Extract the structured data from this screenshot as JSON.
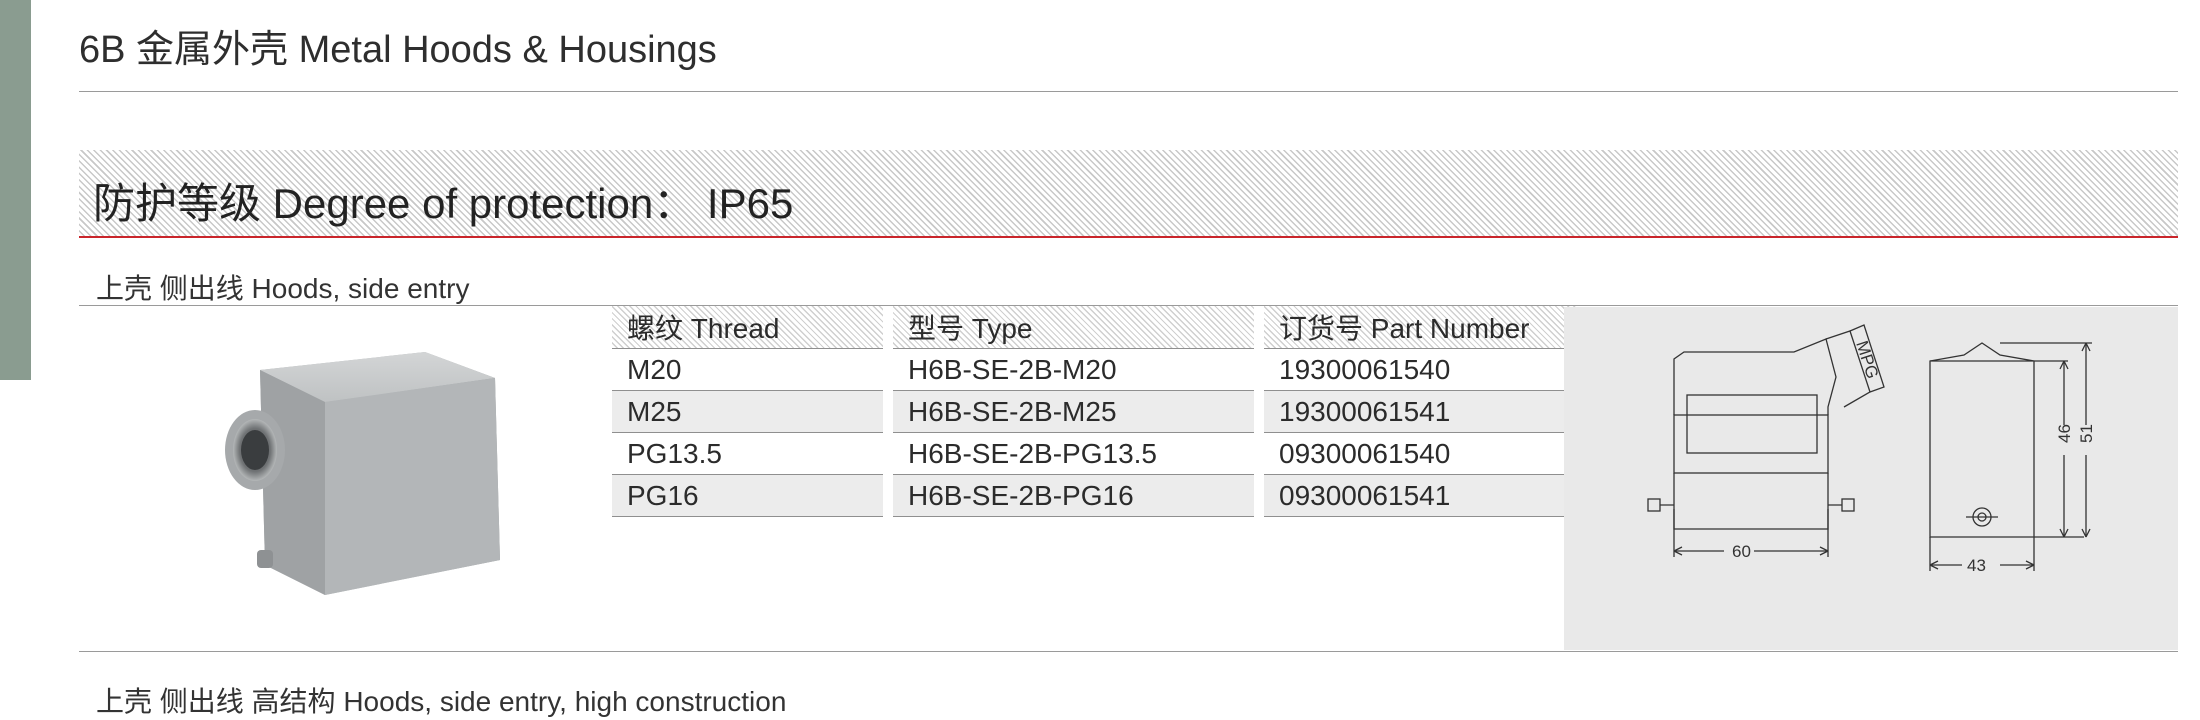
{
  "page": {
    "title": "6B 金属外壳 Metal Hoods & Housings"
  },
  "protection": {
    "heading": "防护等级 Degree of protection： IP65"
  },
  "section": {
    "title": "上壳 侧出线  Hoods, side entry"
  },
  "table": {
    "headers": [
      "螺纹 Thread",
      "型号 Type",
      "订货号 Part Number"
    ],
    "rows": [
      {
        "thread": "M20",
        "type": "H6B-SE-2B-M20",
        "part_number": "19300061540"
      },
      {
        "thread": "M25",
        "type": "H6B-SE-2B-M25",
        "part_number": "19300061541"
      },
      {
        "thread": "PG13.5",
        "type": "H6B-SE-2B-PG13.5",
        "part_number": "09300061540"
      },
      {
        "thread": "PG16",
        "type": "H6B-SE-2B-PG16",
        "part_number": "09300061541"
      }
    ]
  },
  "drawing": {
    "thread_label": "MPG",
    "width_label": "60",
    "depth_label": "43",
    "height_inner_label": "46",
    "height_outer_label": "51"
  },
  "next_section": {
    "title": "上壳 侧出线 高结构 Hoods, side entry, high construction"
  },
  "colors": {
    "side_bar": "#8a9c90",
    "accent_rule": "#c9252b",
    "panel": "#e9e9e9"
  }
}
